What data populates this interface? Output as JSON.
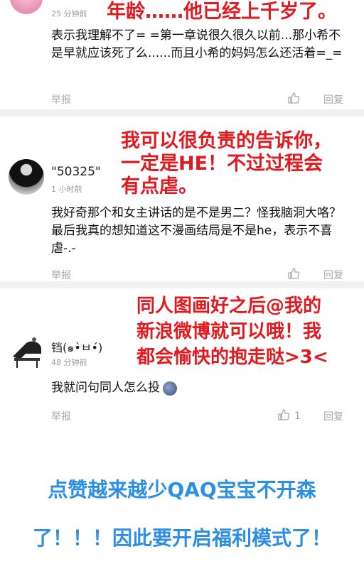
{
  "comments": [
    {
      "user": "",
      "time": "25 分钟前",
      "text": "表示我理解不了= =第一章说很久很久以前...那小希不是早就应该死了么......而且小希的妈妈怎么还活着=_=",
      "report": "举报",
      "reply": "回复",
      "likes": ""
    },
    {
      "user": "\"50325\"",
      "time": "1 小时前",
      "text": "我好奇那个和女主讲话的是不是男二？怪我脑洞大咯？最后我真的想知道这不漫画结局是不是he，表示不喜虐-.-",
      "report": "举报",
      "reply": "回复",
      "likes": ""
    },
    {
      "user": "铛(๑•̀ㅂ•́)",
      "time": "48 分钟前",
      "text": "我就问句同人怎么投",
      "report": "举报",
      "reply": "回复",
      "likes": "1"
    }
  ],
  "annotations": {
    "a1": "年龄……他已经上千岁了。",
    "a2_line1": "我可以很负责的告诉你，",
    "a2_line2": "一定是HE！不过过程会",
    "a2_line3": "有点虐。",
    "a3_line1": "同人图画好之后@我的",
    "a3_line2": "新浪微博就可以哦！我",
    "a3_line3": "都会愉快的抱走哒>3<"
  },
  "footer": {
    "line1": "点赞越来越少QAQ宝宝不开森",
    "line2": "了！！！因此要开启福利模式了！"
  },
  "colors": {
    "annotation_red": "#e2191e",
    "footer_blue": "#2c8fe4",
    "meta_gray": "#a8a8a8"
  }
}
